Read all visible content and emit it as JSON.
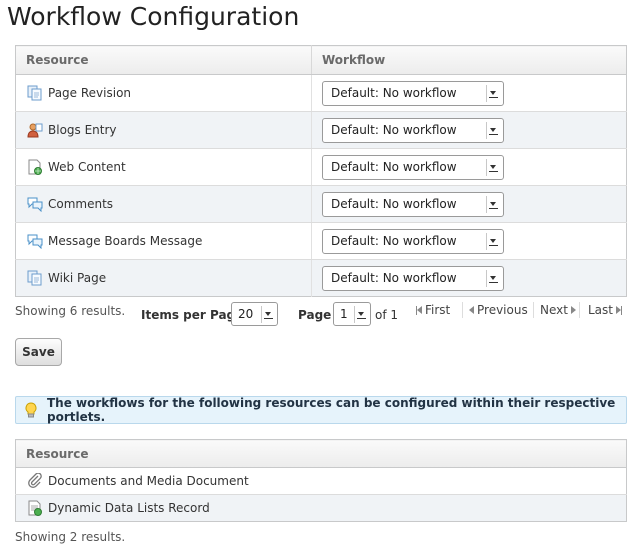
{
  "page": {
    "title": "Workflow Configuration"
  },
  "workflow_table": {
    "headers": {
      "resource": "Resource",
      "workflow": "Workflow"
    },
    "rows": [
      {
        "resource": "Page Revision",
        "icon": "page-revision-icon",
        "workflow": "Default: No workflow"
      },
      {
        "resource": "Blogs Entry",
        "icon": "blogs-entry-icon",
        "workflow": "Default: No workflow"
      },
      {
        "resource": "Web Content",
        "icon": "web-content-icon",
        "workflow": "Default: No workflow"
      },
      {
        "resource": "Comments",
        "icon": "comments-icon",
        "workflow": "Default: No workflow"
      },
      {
        "resource": "Message Boards Message",
        "icon": "message-boards-icon",
        "workflow": "Default: No workflow"
      },
      {
        "resource": "Wiki Page",
        "icon": "wiki-page-icon",
        "workflow": "Default: No workflow"
      }
    ]
  },
  "pagination": {
    "showing": "Showing 6 results.",
    "items_per_page_label": "Items per Page",
    "items_per_page_value": "20",
    "page_label": "Page",
    "page_value": "1",
    "of_label": "of 1",
    "first": "First",
    "previous": "Previous",
    "next": "Next",
    "last": "Last"
  },
  "actions": {
    "save_label": "Save"
  },
  "info": {
    "icon": "lightbulb-icon",
    "text": "The workflows for the following resources can be configured within their respective portlets."
  },
  "portlet_table": {
    "header": "Resource",
    "rows": [
      {
        "resource": "Documents and Media Document",
        "icon": "paperclip-icon"
      },
      {
        "resource": "Dynamic Data Lists Record",
        "icon": "ddl-record-icon"
      }
    ],
    "showing": "Showing 2 results."
  },
  "colors": {
    "row_alt": "#f0f3f6",
    "info_bg": "#e6f3fb",
    "border": "#c8c9ca"
  }
}
